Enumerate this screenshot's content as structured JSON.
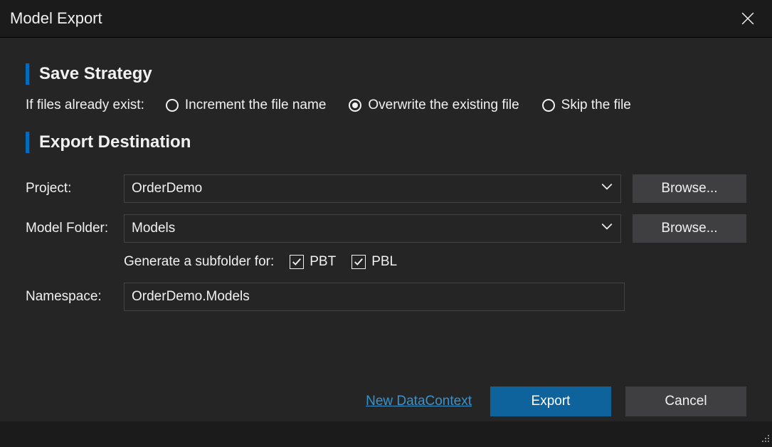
{
  "dialog": {
    "title": "Model Export"
  },
  "sections": {
    "save_strategy_heading": "Save Strategy",
    "export_destination_heading": "Export Destination"
  },
  "save_strategy": {
    "prompt": "If files already exist:",
    "options": {
      "increment": "Increment the file name",
      "overwrite": "Overwrite the existing file",
      "skip": "Skip the file"
    },
    "selected": "overwrite"
  },
  "destination": {
    "project_label": "Project:",
    "project_value": "OrderDemo",
    "project_browse": "Browse...",
    "model_folder_label": "Model Folder:",
    "model_folder_value": "Models",
    "model_folder_browse": "Browse...",
    "subfolder_prompt": "Generate a subfolder for:",
    "subfolder_pbt_label": "PBT",
    "subfolder_pbt_checked": true,
    "subfolder_pbl_label": "PBL",
    "subfolder_pbl_checked": true,
    "namespace_label": "Namespace:",
    "namespace_value": "OrderDemo.Models"
  },
  "footer": {
    "new_datacontext_link": "New DataContext",
    "export_button": "Export",
    "cancel_button": "Cancel"
  }
}
